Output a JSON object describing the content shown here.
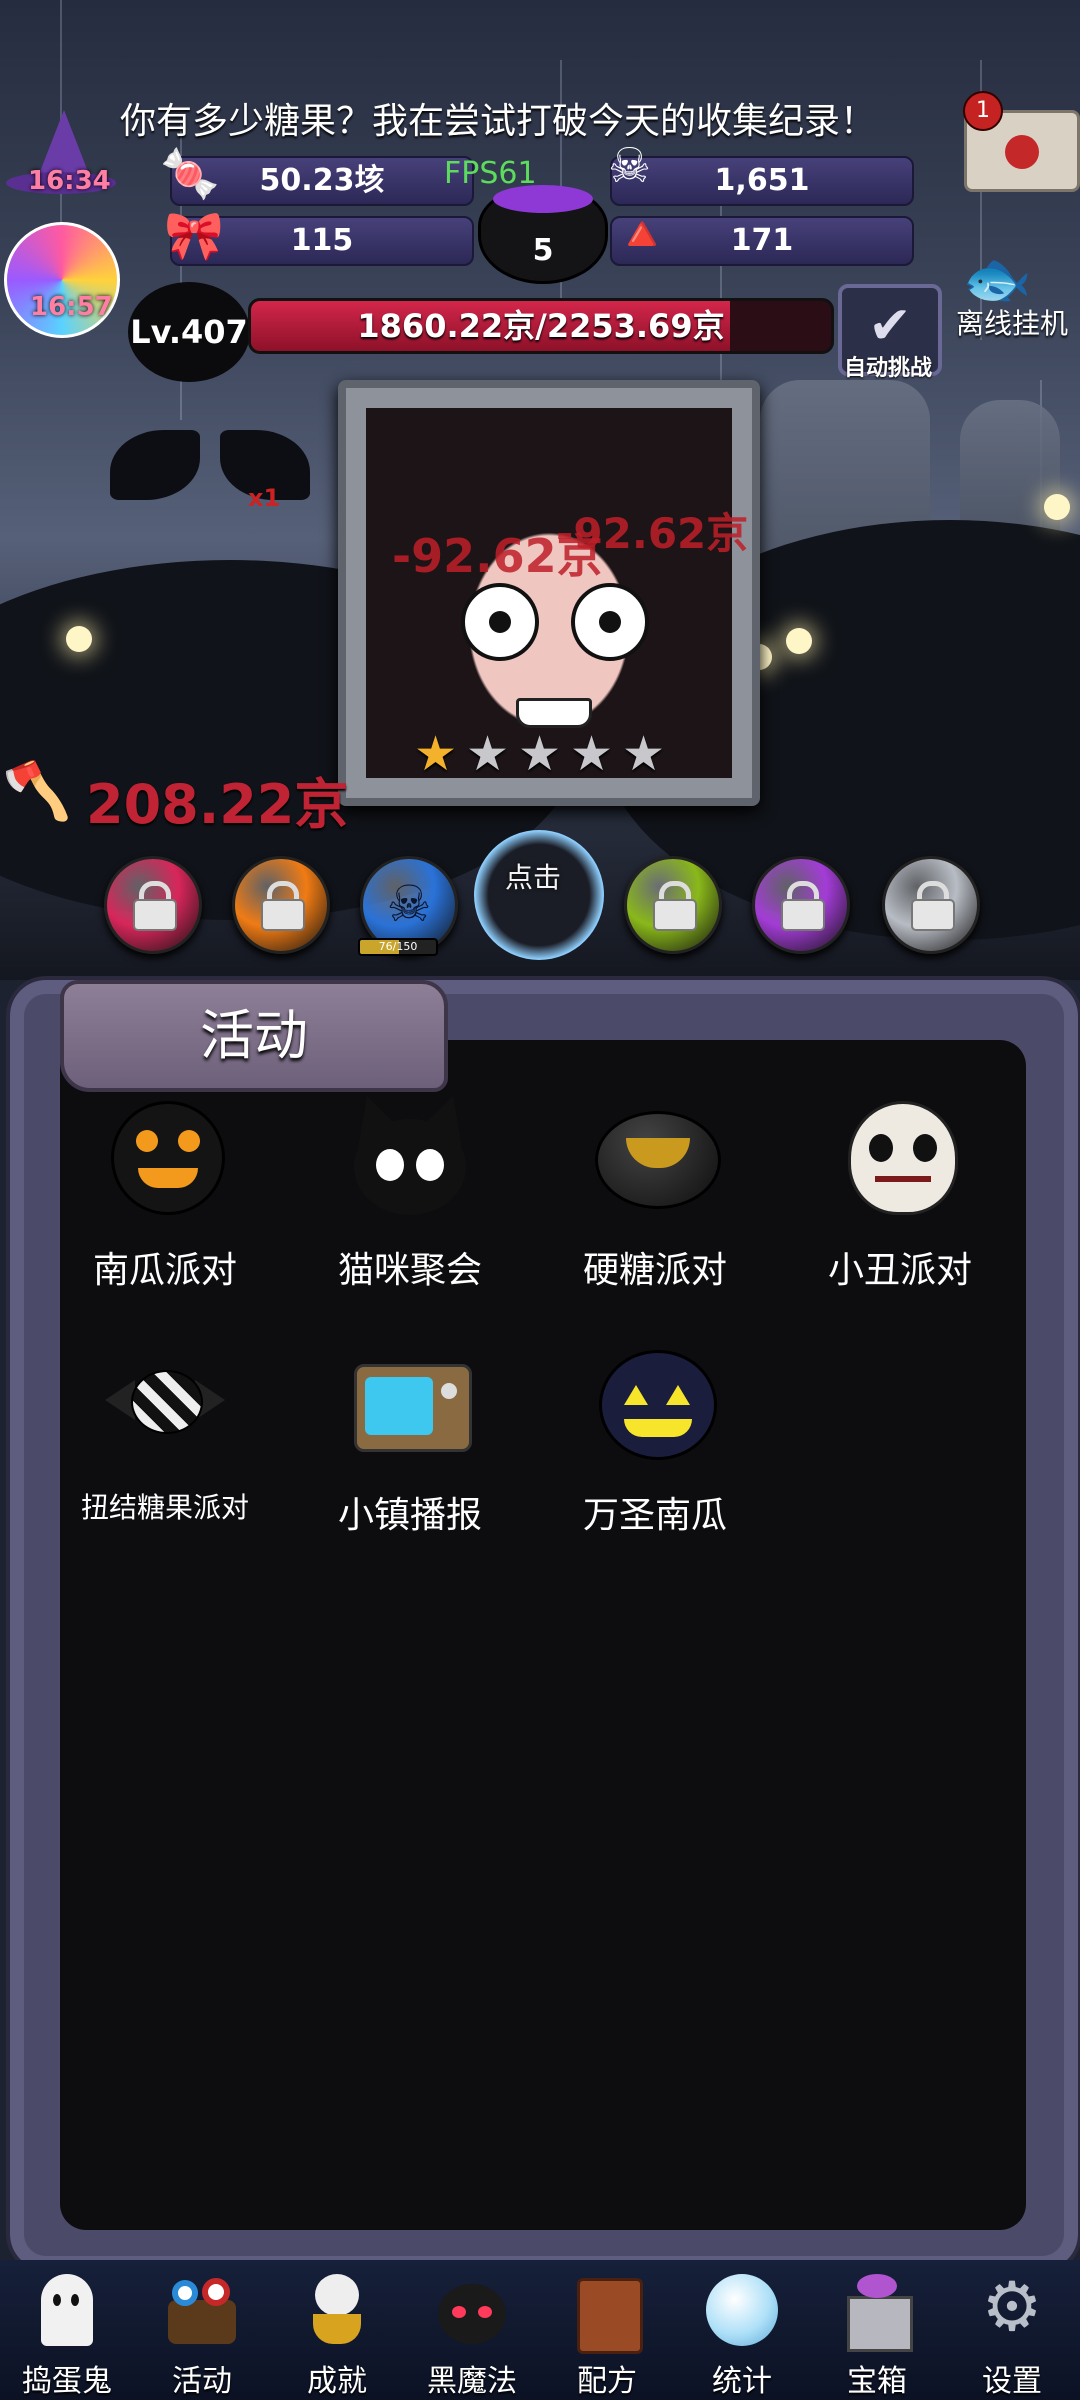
{
  "header": {
    "message": "你有多少糖果？我在尝试打破今天的收集纪录！",
    "mail_badge": "1",
    "timer_hat": "16:34",
    "timer_lolly": "16:57",
    "fps": "FPS61",
    "stats": {
      "candy_total": "50.23垓",
      "skull_count": "1,651",
      "bow_count": "115",
      "candy_corn_count": "171",
      "cauldron_count": "5"
    },
    "level": "Lv.407",
    "hp_text": "1860.22京/2253.69京",
    "hp_fraction": 0.8254,
    "auto_challenge_label": "自动挑战",
    "offline_label": "离线挂机"
  },
  "boss": {
    "stars_filled": 1,
    "stars_total": 5,
    "damage_floats": [
      "-92.62京",
      "-92.62京"
    ],
    "axe_damage": "208.22京",
    "bat_multiplier": "x1"
  },
  "orbs": {
    "progress_text": "76/150",
    "progress_fraction": 0.5067,
    "tap_label": "点击",
    "items": [
      {
        "color": "#d8265a",
        "locked": true
      },
      {
        "color": "#f07b14",
        "locked": true
      },
      {
        "color": "#2a72d8",
        "locked": false
      },
      {
        "color": "#8ab81a",
        "locked": true
      },
      {
        "color": "#a33cd6",
        "locked": true
      },
      {
        "color": "#b8bcc4",
        "locked": true
      }
    ]
  },
  "activities": {
    "title": "活动",
    "items": [
      {
        "label": "南瓜派对",
        "icon": "pumpkin-lollipop-icon"
      },
      {
        "label": "猫咪聚会",
        "icon": "black-cat-icon"
      },
      {
        "label": "硬糖派对",
        "icon": "hard-candy-icon"
      },
      {
        "label": "小丑派对",
        "icon": "skull-lollipop-icon"
      },
      {
        "label": "扭结糖果派对",
        "icon": "wrapped-candy-icon"
      },
      {
        "label": "小镇播报",
        "icon": "tv-icon"
      },
      {
        "label": "万圣南瓜",
        "icon": "jack-o-lantern-icon"
      }
    ]
  },
  "nav": [
    {
      "label": "捣蛋鬼",
      "icon": "ghost-icon"
    },
    {
      "label": "活动",
      "icon": "eyeball-cake-icon"
    },
    {
      "label": "成就",
      "icon": "skull-trophy-icon"
    },
    {
      "label": "黑魔法",
      "icon": "demon-icon"
    },
    {
      "label": "配方",
      "icon": "spellbook-icon"
    },
    {
      "label": "统计",
      "icon": "crystal-ball-icon"
    },
    {
      "label": "宝箱",
      "icon": "gift-box-icon"
    },
    {
      "label": "设置",
      "icon": "gear-icon"
    }
  ]
}
